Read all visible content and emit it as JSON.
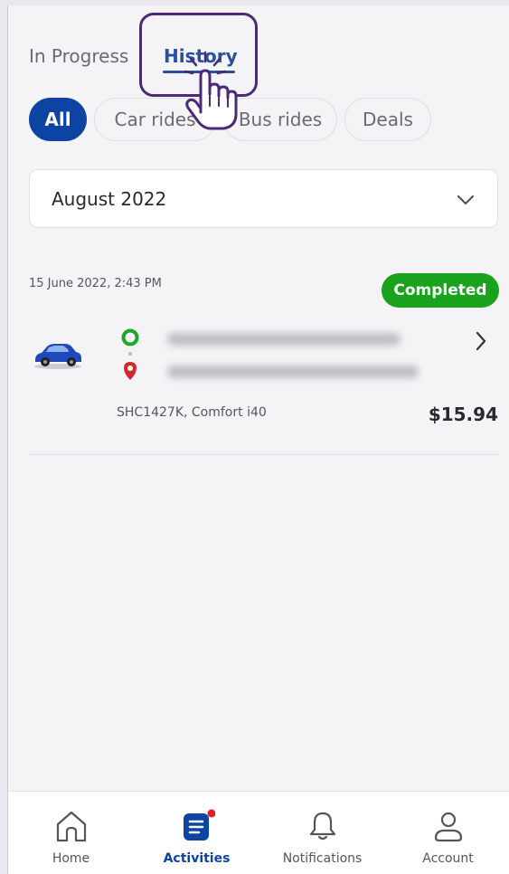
{
  "tabs": {
    "in_progress": "In Progress",
    "history": "History",
    "active": "history"
  },
  "filters": {
    "chips": [
      "All",
      "Car rides",
      "Bus rides",
      "Deals"
    ],
    "selected": "All"
  },
  "month_select": {
    "value": "August 2022"
  },
  "ride": {
    "datetime": "15 June 2022, 2:43 PM",
    "status": "Completed",
    "vehicle": "SHC1427K, Comfort i40",
    "price": "$15.94"
  },
  "bottom_nav": {
    "items": [
      "Home",
      "Activities",
      "Notifications",
      "Account"
    ],
    "active": "Activities"
  },
  "colors": {
    "primary": "#0d44a3",
    "status_completed": "#19a21b",
    "highlight": "#4b2a78",
    "notification_dot": "#e02020"
  },
  "icons": {
    "nav": [
      "home-icon",
      "activities-icon",
      "bell-icon",
      "user-icon"
    ],
    "ride": [
      "car-icon",
      "pickup-icon",
      "dropoff-pin-icon",
      "chevron-right-icon"
    ],
    "select": "chevron-down-icon",
    "annotation": "pointer-hand-icon"
  }
}
